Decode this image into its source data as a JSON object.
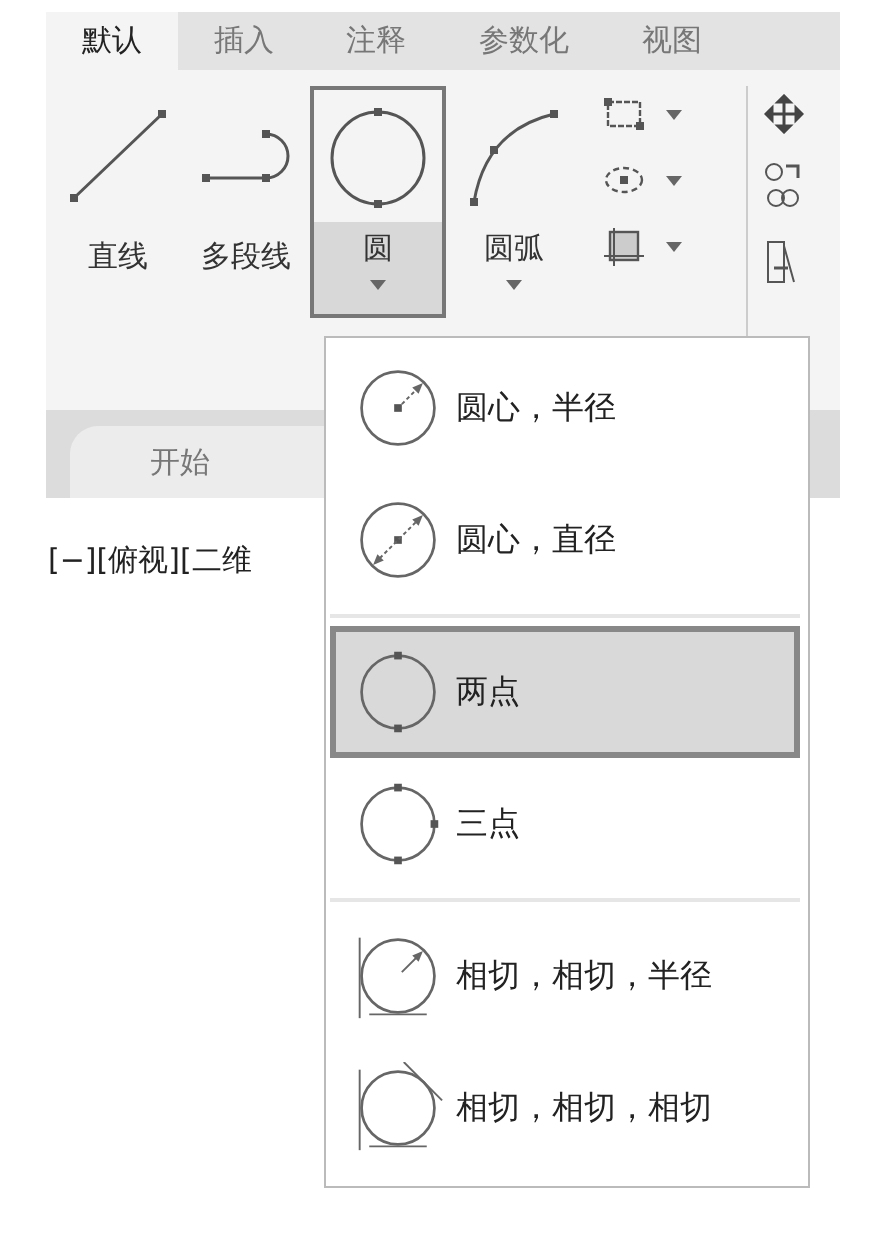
{
  "ribbon_tabs": [
    {
      "label": "默认",
      "selected": true
    },
    {
      "label": "插入",
      "selected": false
    },
    {
      "label": "注释",
      "selected": false
    },
    {
      "label": "参数化",
      "selected": false
    },
    {
      "label": "视图",
      "selected": false
    }
  ],
  "draw_tools": [
    {
      "label": "直线",
      "kind": "line",
      "selected": false
    },
    {
      "label": "多段线",
      "kind": "polyline",
      "selected": false
    },
    {
      "label": "圆",
      "kind": "circle",
      "selected": true
    },
    {
      "label": "圆弧",
      "kind": "arc",
      "selected": false
    }
  ],
  "file_tabs": [
    {
      "label": "开始",
      "selected": true
    }
  ],
  "viewport_label": "[−][俯视][二维",
  "circle_menu": {
    "groups": [
      [
        {
          "label": "圆心，半径",
          "kind": "center-radius",
          "selected": false
        },
        {
          "label": "圆心，直径",
          "kind": "center-diameter",
          "selected": false
        }
      ],
      [
        {
          "label": "两点",
          "kind": "two-point",
          "selected": true
        },
        {
          "label": "三点",
          "kind": "three-point",
          "selected": false
        }
      ],
      [
        {
          "label": "相切，相切，半径",
          "kind": "tan-tan-radius",
          "selected": false
        },
        {
          "label": "相切，相切，相切",
          "kind": "tan-tan-tan",
          "selected": false
        }
      ]
    ]
  }
}
